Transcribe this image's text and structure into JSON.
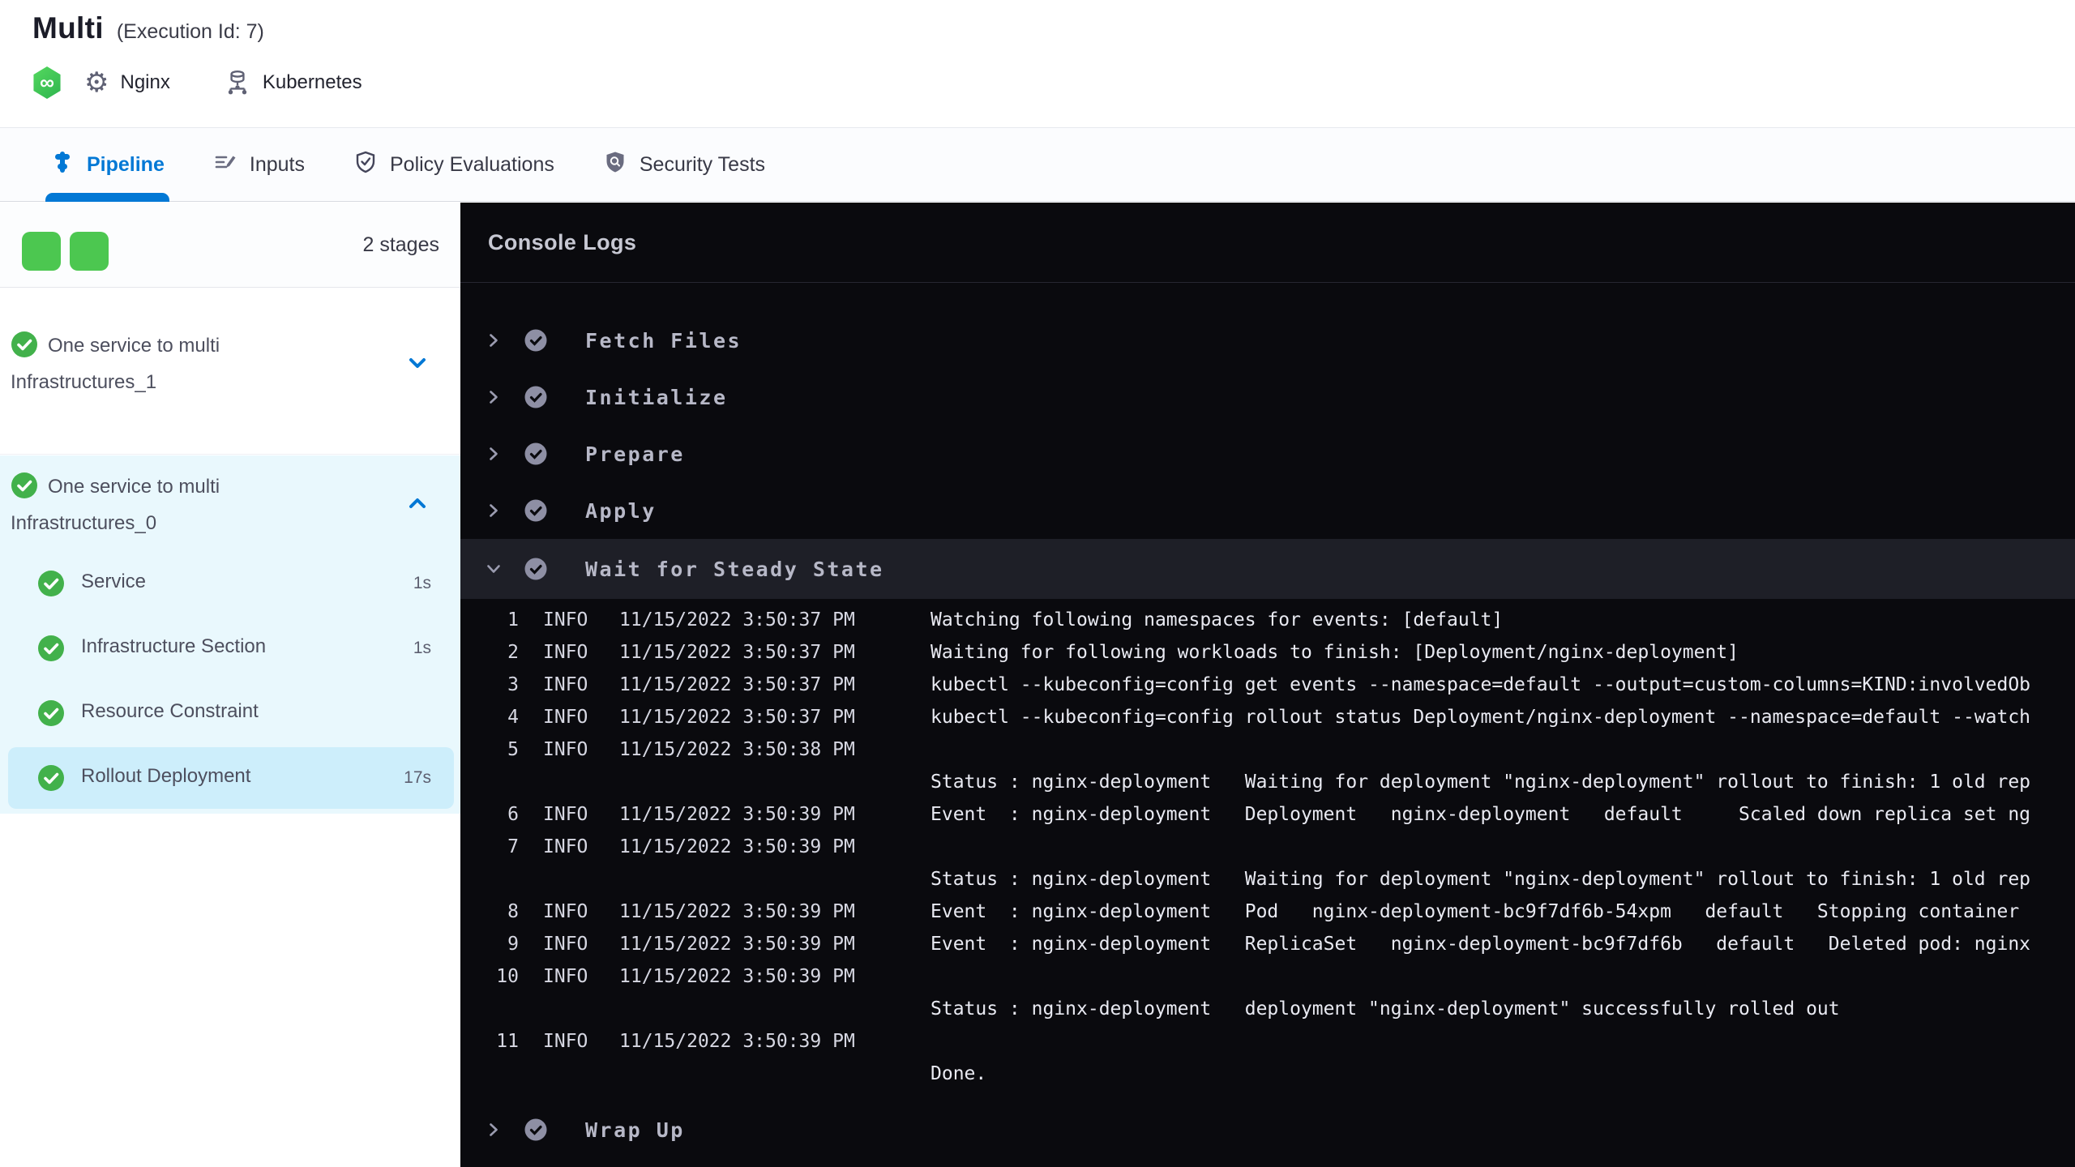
{
  "colors": {
    "accent": "#0278d5",
    "success_green": "#4cc750",
    "console_bg": "#0a0a0e",
    "stage_section_bg": "#e9f8fd",
    "selected_step_bg": "#cdeefb",
    "selected_section_bg": "#1e1f27"
  },
  "icons": {
    "infinity_glyph": "∞",
    "gear_glyph": "⚙"
  },
  "header": {
    "title": "Multi",
    "execution_id": "(Execution Id: 7)",
    "service_label": "Nginx",
    "infra_label": "Kubernetes"
  },
  "tabs": [
    {
      "label": "Pipeline",
      "active": true
    },
    {
      "label": "Inputs",
      "active": false
    },
    {
      "label": "Policy Evaluations",
      "active": false
    },
    {
      "label": "Security Tests",
      "active": false
    }
  ],
  "sidebar": {
    "stages_count": "2 stages",
    "stages": [
      {
        "name": "One service to multi Infrastructures_1",
        "status": "success",
        "expanded": false
      },
      {
        "name": "One service to multi Infrastructures_0",
        "status": "success",
        "expanded": true,
        "steps": [
          {
            "name": "Service",
            "duration": "1s",
            "selected": false
          },
          {
            "name": "Infrastructure Section",
            "duration": "1s",
            "selected": false
          },
          {
            "name": "Resource Constraint",
            "duration": "",
            "selected": false
          },
          {
            "name": "Rollout Deployment",
            "duration": "17s",
            "selected": true
          }
        ]
      }
    ]
  },
  "console": {
    "title": "Console Logs",
    "sections": [
      {
        "label": "Fetch Files",
        "expanded": false
      },
      {
        "label": "Initialize",
        "expanded": false
      },
      {
        "label": "Prepare",
        "expanded": false
      },
      {
        "label": "Apply",
        "expanded": false
      },
      {
        "label": "Wait for Steady State",
        "expanded": true
      },
      {
        "label": "Wrap Up",
        "expanded": false
      }
    ],
    "logs": [
      {
        "num": "1",
        "level": "INFO",
        "time": "11/15/2022 3:50:37 PM",
        "msg": "Watching following namespaces for events: [default]"
      },
      {
        "num": "2",
        "level": "INFO",
        "time": "11/15/2022 3:50:37 PM",
        "msg": "Waiting for following workloads to finish: [Deployment/nginx-deployment]"
      },
      {
        "num": "3",
        "level": "INFO",
        "time": "11/15/2022 3:50:37 PM",
        "msg": "kubectl --kubeconfig=config get events --namespace=default --output=custom-columns=KIND:involvedOb"
      },
      {
        "num": "4",
        "level": "INFO",
        "time": "11/15/2022 3:50:37 PM",
        "msg": "kubectl --kubeconfig=config rollout status Deployment/nginx-deployment --namespace=default --watch"
      },
      {
        "num": "5",
        "level": "INFO",
        "time": "11/15/2022 3:50:38 PM",
        "msg": ""
      },
      {
        "num": "",
        "level": "",
        "time": "",
        "msg": "Status : nginx-deployment   Waiting for deployment \"nginx-deployment\" rollout to finish: 1 old rep"
      },
      {
        "num": "6",
        "level": "INFO",
        "time": "11/15/2022 3:50:39 PM",
        "msg": "Event  : nginx-deployment   Deployment   nginx-deployment   default     Scaled down replica set ng"
      },
      {
        "num": "7",
        "level": "INFO",
        "time": "11/15/2022 3:50:39 PM",
        "msg": ""
      },
      {
        "num": "",
        "level": "",
        "time": "",
        "msg": "Status : nginx-deployment   Waiting for deployment \"nginx-deployment\" rollout to finish: 1 old rep"
      },
      {
        "num": "8",
        "level": "INFO",
        "time": "11/15/2022 3:50:39 PM",
        "msg": "Event  : nginx-deployment   Pod   nginx-deployment-bc9f7df6b-54xpm   default   Stopping container "
      },
      {
        "num": "9",
        "level": "INFO",
        "time": "11/15/2022 3:50:39 PM",
        "msg": "Event  : nginx-deployment   ReplicaSet   nginx-deployment-bc9f7df6b   default   Deleted pod: nginx"
      },
      {
        "num": "10",
        "level": "INFO",
        "time": "11/15/2022 3:50:39 PM",
        "msg": ""
      },
      {
        "num": "",
        "level": "",
        "time": "",
        "msg": "Status : nginx-deployment   deployment \"nginx-deployment\" successfully rolled out"
      },
      {
        "num": "11",
        "level": "INFO",
        "time": "11/15/2022 3:50:39 PM",
        "msg": ""
      },
      {
        "num": "",
        "level": "",
        "time": "",
        "msg": "Done."
      }
    ]
  }
}
